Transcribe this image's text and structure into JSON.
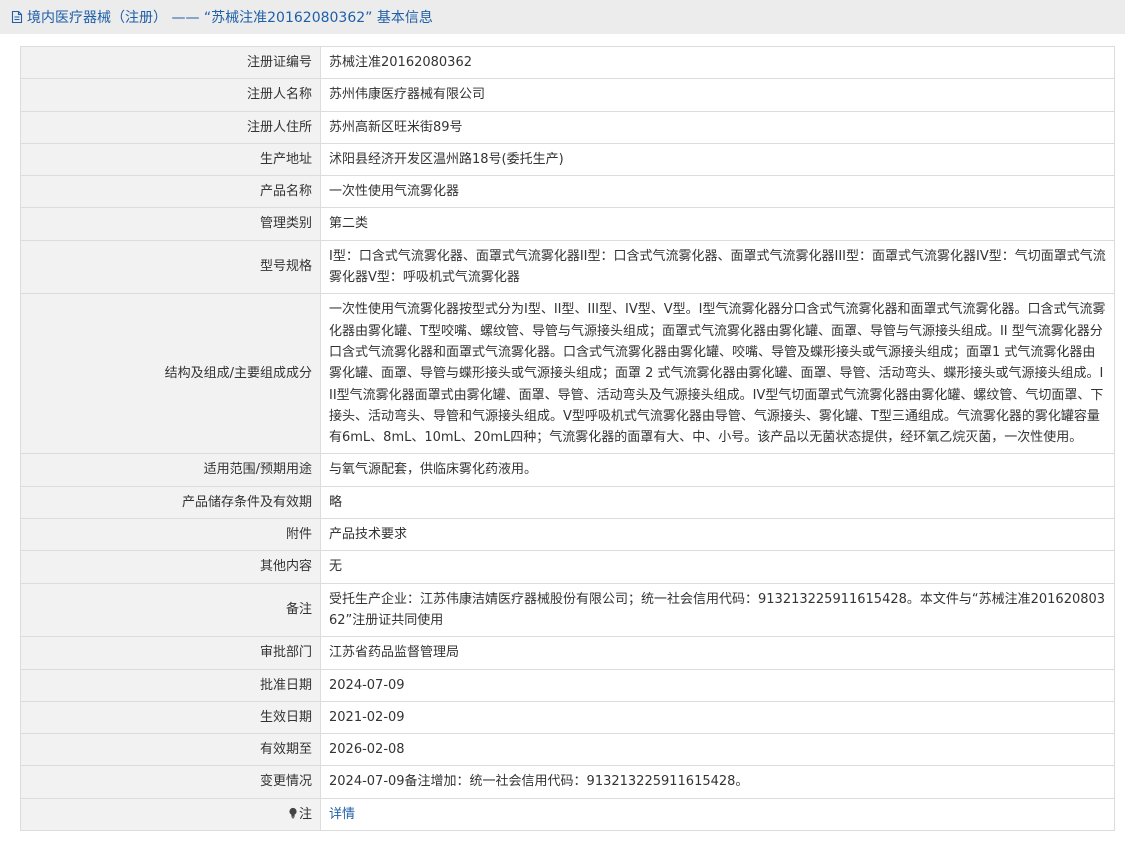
{
  "header": {
    "title": "境内医疗器械（注册） —— “苏械注准20162080362” 基本信息"
  },
  "rows": [
    {
      "label": "注册证编号",
      "value": "苏械注准20162080362"
    },
    {
      "label": "注册人名称",
      "value": "苏州伟康医疗器械有限公司"
    },
    {
      "label": "注册人住所",
      "value": "苏州高新区旺米街89号"
    },
    {
      "label": "生产地址",
      "value": "沭阳县经济开发区温州路18号(委托生产)"
    },
    {
      "label": "产品名称",
      "value": "一次性使用气流雾化器"
    },
    {
      "label": "管理类别",
      "value": "第二类"
    },
    {
      "label": "型号规格",
      "value": "I型：口含式气流雾化器、面罩式气流雾化器II型：口含式气流雾化器、面罩式气流雾化器III型：面罩式气流雾化器IV型：气切面罩式气流雾化器Ⅴ型：呼吸机式气流雾化器"
    },
    {
      "label": "结构及组成/主要组成成分",
      "value": "一次性使用气流雾化器按型式分为I型、II型、III型、IV型、Ⅴ型。I型气流雾化器分口含式气流雾化器和面罩式气流雾化器。口含式气流雾化器由雾化罐、T型咬嘴、螺纹管、导管与气源接头组成；面罩式气流雾化器由雾化罐、面罩、导管与气源接头组成。II 型气流雾化器分口含式气流雾化器和面罩式气流雾化器。口含式气流雾化器由雾化罐、咬嘴、导管及蝶形接头或气源接头组成；面罩1 式气流雾化器由雾化罐、面罩、导管与蝶形接头或气源接头组成；面罩 2 式气流雾化器由雾化罐、面罩、导管、活动弯头、蝶形接头或气源接头组成。III型气流雾化器面罩式由雾化罐、面罩、导管、活动弯头及气源接头组成。IV型气切面罩式气流雾化器由雾化罐、螺纹管、气切面罩、下接头、活动弯头、导管和气源接头组成。Ⅴ型呼吸机式气流雾化器由导管、气源接头、雾化罐、T型三通组成。气流雾化器的雾化罐容量有6mL、8mL、10mL、20mL四种；气流雾化器的面罩有大、中、小号。该产品以无菌状态提供，经环氧乙烷灭菌，一次性使用。"
    },
    {
      "label": "适用范围/预期用途",
      "value": "与氧气源配套，供临床雾化药液用。"
    },
    {
      "label": "产品储存条件及有效期",
      "value": "略"
    },
    {
      "label": "附件",
      "value": "产品技术要求"
    },
    {
      "label": "其他内容",
      "value": "无"
    },
    {
      "label": "备注",
      "value": "受托生产企业：江苏伟康洁婧医疗器械股份有限公司；统一社会信用代码：913213225911615428。本文件与“苏械注准20162080362”注册证共同使用"
    },
    {
      "label": "审批部门",
      "value": "江苏省药品监督管理局"
    },
    {
      "label": "批准日期",
      "value": "2024-07-09"
    },
    {
      "label": "生效日期",
      "value": "2021-02-09"
    },
    {
      "label": "有效期至",
      "value": "2026-02-08"
    },
    {
      "label": "变更情况",
      "value": "2024-07-09备注增加：统一社会信用代码：913213225911615428。"
    }
  ],
  "note": {
    "label": "注",
    "link": "详情",
    "icon": "lightbulb-icon"
  },
  "colors": {
    "accent": "#1e5fa8",
    "label_bg": "#f2f2f2",
    "border": "#dcdcdc",
    "title_bg": "#ececec"
  }
}
